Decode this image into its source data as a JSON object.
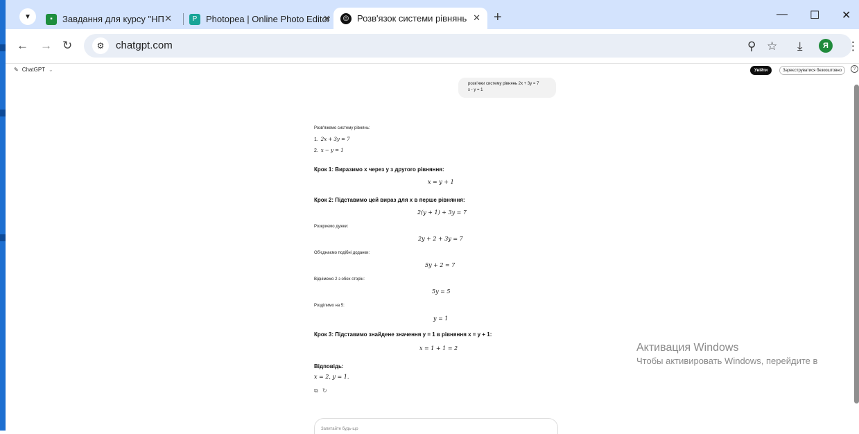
{
  "browser": {
    "tabs": [
      {
        "title": "Завдання для курсу \"НП \"Циф",
        "favicon": "classroom-icon",
        "active": false
      },
      {
        "title": "Photopea | Online Photo Editor",
        "favicon": "photopea-icon",
        "active": false
      },
      {
        "title": "Розв'язок системи рівнянь",
        "favicon": "chatgpt-icon",
        "active": true
      }
    ],
    "close_glyph": "✕",
    "new_tab_glyph": "+",
    "url": "chatgpt.com",
    "profile_initial": "Я"
  },
  "app": {
    "brand": "ChatGPT",
    "login_label": "Увійти",
    "signup_label": "Зареєструватися безкоштовно"
  },
  "chat": {
    "user_message": [
      "розв'яжи систему рівнянь 2x + 3y = 7",
      "x - y = 1"
    ],
    "intro": "Розв'яжемо систему рівнянь:",
    "system": [
      "2x + 3y = 7",
      "x − y = 1"
    ],
    "step1_title": "Крок 1: Виразимо x через y з другого рівняння:",
    "step1_eq": "x = y + 1",
    "step2_title": "Крок 2: Підставимо цей вираз для x в перше рівняння:",
    "step2_eq": "2(y + 1) + 3y = 7",
    "note1": "Розкриємо дужки:",
    "eq_a": "2y + 2 + 3y = 7",
    "note2": "Об'єднаємо подібні доданки:",
    "eq_b": "5y + 2 = 7",
    "note3": "Віднімемо 2 з обох сторін:",
    "eq_c": "5y = 5",
    "note4": "Розділимо на 5:",
    "eq_d": "y = 1",
    "step3_title": "Крок 3: Підставимо знайдене значення y = 1 в рівняння x = y + 1:",
    "step3_eq": "x = 1 + 1 = 2",
    "answer_title": "Відповідь:",
    "answer": "x = 2, y = 1.",
    "composer_placeholder": "Запитайте будь-що"
  },
  "os": {
    "activation_title": "Активация Windows",
    "activation_text": "Чтобы активировать Windows, перейдите в"
  }
}
